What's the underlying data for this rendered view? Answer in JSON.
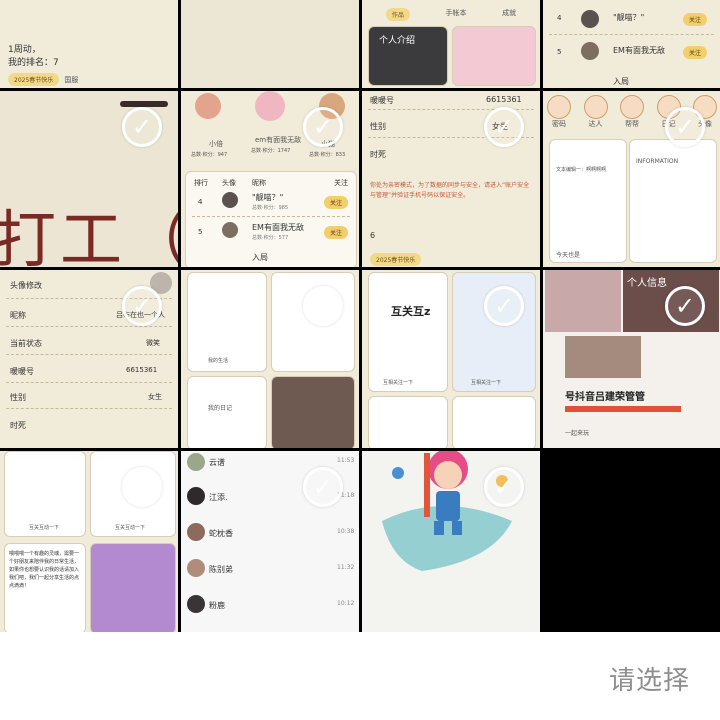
{
  "tiles": {
    "t1": {
      "lines": [
        "1周动，",
        "我的排名：7"
      ],
      "pill": "2025春节快乐",
      "pill_side": "国服"
    },
    "t3": {
      "tabs": [
        "作品",
        "手帐本",
        "成就"
      ],
      "thumb_label": "个人介绍"
    },
    "t4": {
      "rows": [
        {
          "rank": "4",
          "name": "\"靓喵？\"",
          "follow": "关注"
        },
        {
          "rank": "5",
          "name": "EM有面我无敌",
          "follow": "关注"
        },
        {
          "rank": "",
          "name": "入局",
          "follow": ""
        }
      ]
    },
    "t5": {
      "big_text": "打工（"
    },
    "t6": {
      "top_left": "小倍",
      "top_mid": "em有面我无敌",
      "top_right": "小猫",
      "stats_left": "总数·积分：947",
      "stats_mid": "总数·积分：1747",
      "stats_right": "总数·积分：833",
      "headers": [
        "排行",
        "头像",
        "昵称",
        "关注"
      ],
      "rows": [
        {
          "rank": "4",
          "name": "\"靓喵？\"",
          "sub": "总数·积分：985",
          "follow": "关注"
        },
        {
          "rank": "5",
          "name": "EM有面我无敌",
          "sub": "总数·积分：577",
          "follow": "关注"
        },
        {
          "rank": "",
          "name": "入局",
          "sub": "",
          "follow": ""
        }
      ]
    },
    "t7": {
      "label_nick": "暖暖号",
      "value_nick": "6615361",
      "label_gender": "性别",
      "value_gender": "女生",
      "label_sign": "时死",
      "notice": "你处为亲密模式，为了数据的同步与安全，请进入“账户安全与管理”并验证手机号码以保证安全。",
      "footer_num": "6",
      "pill": "2025春节快乐"
    },
    "t8": {
      "icons": [
        "密码",
        "达人",
        "帮帮",
        "日记",
        "头像"
      ],
      "left_title": "文本编辑一：啊啊啊啊",
      "right_title": "INFORMATION",
      "left_bottom": "今天也是"
    },
    "t9": {
      "rows": [
        {
          "label": "头像修改",
          "value": ""
        },
        {
          "label": "昵称",
          "value": "吕布在也一个人"
        },
        {
          "label": "当前状态",
          "value": "微笑"
        },
        {
          "label": "暖暖号",
          "value": "6615361"
        },
        {
          "label": "性别",
          "value": "女生"
        },
        {
          "label": "时死",
          "value": ""
        }
      ]
    },
    "t10": {
      "label_a": "我的生活",
      "label_b": "我的日记"
    },
    "t11": {
      "title": "互关互z",
      "caption_a": "互相关注一下",
      "caption_b": "互相关注一下"
    },
    "t12": {
      "overlay": "个人信息",
      "headline": "号抖音吕建荣管管",
      "footer": "一起来玩"
    },
    "t13": {
      "caption_a": "互关互动一下",
      "caption_b": "互关互动一下",
      "text_block": "喂喂喂一个有趣的灵魂，需要一个好朋友来陪伴我的日常生活，如果你也想要认识我的话请加入我们吧，我们一起分享生活的点点滴滴！"
    },
    "t14": {
      "rows": [
        {
          "name": "云谱",
          "time": "11:53"
        },
        {
          "name": "江添.",
          "time": "11:18"
        },
        {
          "name": "蛇枕香",
          "time": "10:38"
        },
        {
          "name": "陈别弟",
          "time": "11:32"
        },
        {
          "name": "粉鹿",
          "time": "10:12"
        }
      ]
    }
  },
  "check_glyph": "✓",
  "footer": {
    "choose_label": "请选择"
  },
  "colors": {
    "cream": "#f1ebda",
    "gold": "#f2cf6b",
    "check": "#ffffff"
  }
}
